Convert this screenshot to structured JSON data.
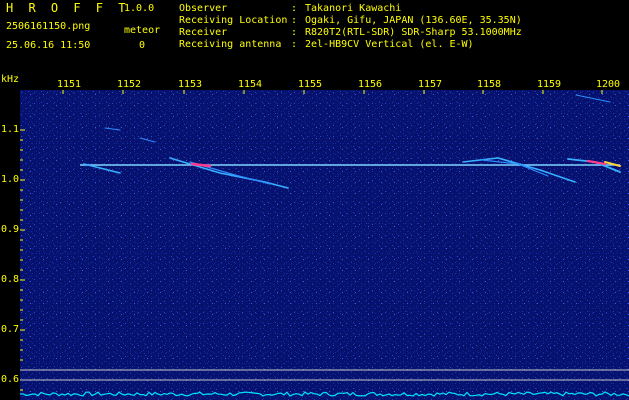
{
  "app": {
    "name": "H R O F F T",
    "version": "1.0.0"
  },
  "file": {
    "name": "2506161150.png",
    "datetime": "25.06.16 11:50"
  },
  "meteor": {
    "label": "meteor",
    "count": "0"
  },
  "station": [
    {
      "key": "Observer",
      "value": "Takanori Kawachi"
    },
    {
      "key": "Receiving Location",
      "value": "Ogaki, Gifu, JAPAN (136.60E, 35.35N)"
    },
    {
      "key": "Receiver",
      "value": "R820T2(RTL-SDR) SDR-Sharp 53.1000MHz"
    },
    {
      "key": "Receiving antenna",
      "value": "2el-HB9CV Vertical (el. E-W)"
    }
  ],
  "axis": {
    "unit": "kHz",
    "x_ticks": [
      "1151",
      "1152",
      "1153",
      "1154",
      "1155",
      "1156",
      "1157",
      "1158",
      "1159",
      "1200"
    ],
    "y_ticks": [
      "1.1",
      "1.0",
      "0.9",
      "0.8",
      "0.7",
      "0.6"
    ]
  },
  "colors": {
    "label": "#ffff00",
    "background": "#000000",
    "noise": "#0a1a8a",
    "signal": "#7fd4ff"
  }
}
